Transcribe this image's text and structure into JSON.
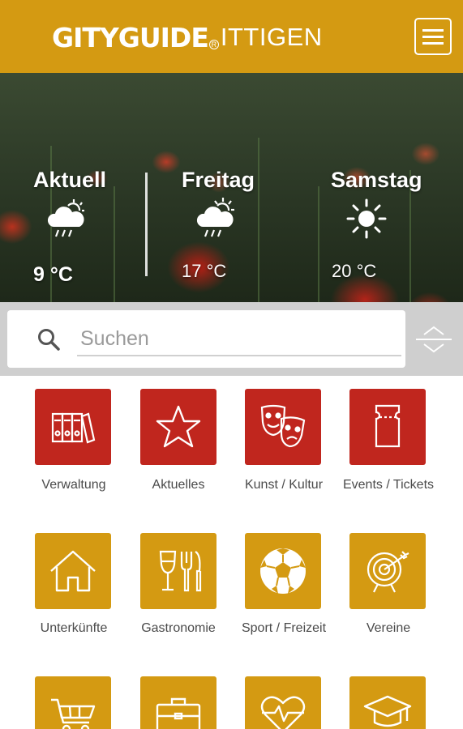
{
  "header": {
    "brand": "GITYGUIDE",
    "registered": "R",
    "city": "ITTIGEN",
    "menu_icon": "hamburger-menu-icon"
  },
  "weather": {
    "current": {
      "day": "Aktuell",
      "temp": "9 °C",
      "icon": "cloud-rain-icon"
    },
    "day1": {
      "day": "Freitag",
      "temp": "17 °C",
      "icon": "sun-cloud-rain-icon"
    },
    "day2": {
      "day": "Samstag",
      "temp": "20 °C",
      "icon": "sun-icon"
    }
  },
  "search": {
    "placeholder": "Suchen",
    "value": "",
    "icon": "search-icon",
    "sort_icon": "expand-collapse-icon"
  },
  "categories": [
    {
      "label": "Verwaltung",
      "icon": "binders-icon",
      "color": "#c0261e"
    },
    {
      "label": "Aktuelles",
      "icon": "star-icon",
      "color": "#c0261e"
    },
    {
      "label": "Kunst / Kultur",
      "icon": "theater-masks-icon",
      "color": "#c0261e"
    },
    {
      "label": "Events / Tickets",
      "icon": "ticket-icon",
      "color": "#c0261e"
    },
    {
      "label": "Unterkünfte",
      "icon": "house-icon",
      "color": "#d49a12"
    },
    {
      "label": "Gastronomie",
      "icon": "wine-cutlery-icon",
      "color": "#d49a12"
    },
    {
      "label": "Sport / Freizeit",
      "icon": "soccer-ball-icon",
      "color": "#d49a12"
    },
    {
      "label": "Vereine",
      "icon": "target-icon",
      "color": "#d49a12"
    },
    {
      "label": "",
      "icon": "shopping-cart-icon",
      "color": "#d49a12"
    },
    {
      "label": "",
      "icon": "briefcase-icon",
      "color": "#d49a12"
    },
    {
      "label": "",
      "icon": "heart-pulse-icon",
      "color": "#d49a12"
    },
    {
      "label": "",
      "icon": "graduation-cap-icon",
      "color": "#d49a12"
    }
  ],
  "colors": {
    "accent": "#d49a12",
    "red": "#c0261e"
  }
}
